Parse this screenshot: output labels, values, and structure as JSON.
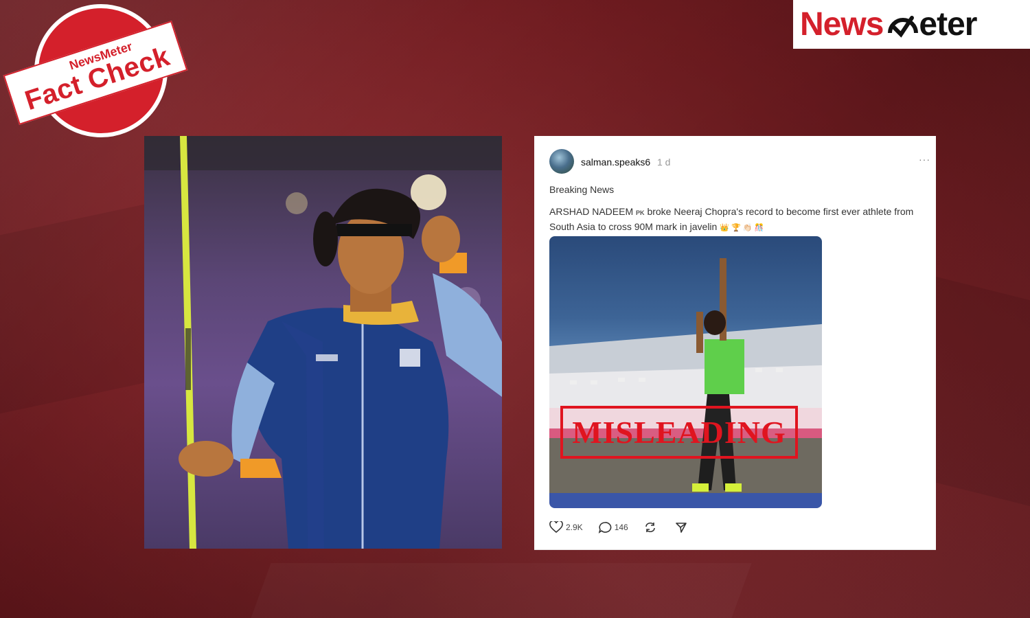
{
  "stamp": {
    "brand": "NewsMeter",
    "text": "Fact Check"
  },
  "logo": {
    "part1": "News",
    "part2": "eter"
  },
  "post": {
    "username": "salman.speaks6",
    "time": "1 d",
    "more": "···",
    "heading": "Breaking News",
    "body_part1": "ARSHAD NADEEM",
    "flag": "PK",
    "body_part2": "broke Neeraj Chopra's record to become first ever athlete from South Asia to cross 90M mark in javelin",
    "emojis": "👑 🏆 👏🏻 🎊",
    "overlay_label": "MISLEADING",
    "likes": "2.9K",
    "replies": "146"
  }
}
